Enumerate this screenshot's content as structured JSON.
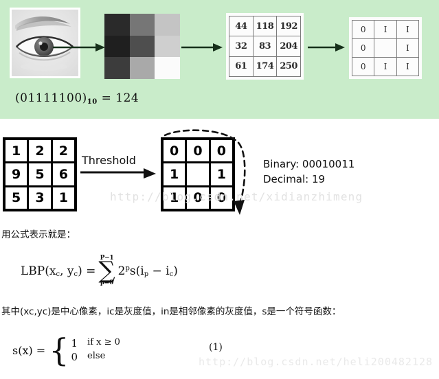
{
  "colors": {
    "panel_background": "#c9ecca",
    "page_background": "#ffffff",
    "arrow": "#16301a",
    "matrix_border": "#7b7b7b",
    "watermark": "#e2e2e2",
    "variable_blue": "#1a3fd0"
  },
  "green_panel": {
    "eye_image_alt": "grayscale eye photograph",
    "gray_patch": {
      "caption": "3x3 grayscale neighbourhood",
      "cells": [
        "#2a2a2a",
        "#767676",
        "#c4c4c4",
        "#1f1f1f",
        "#4e4e4e",
        "#cfcfcf",
        "#3c3c3c",
        "#a9a9a9",
        "#fbfbfb"
      ]
    },
    "numeric_matrix": {
      "rows": [
        [
          "44",
          "118",
          "192"
        ],
        [
          "32",
          "83",
          "204"
        ],
        [
          "61",
          "174",
          "250"
        ]
      ]
    },
    "binary_matrix": {
      "rows": [
        [
          "0",
          "I",
          "I"
        ],
        [
          "0",
          "",
          "I"
        ],
        [
          "0",
          "I",
          "I"
        ]
      ]
    },
    "caption": {
      "binary": "(01111100)",
      "base": "10",
      "equals": " = 124"
    }
  },
  "threshold_diagram": {
    "source_matrix": {
      "rows": [
        [
          "1",
          "2",
          "2"
        ],
        [
          "9",
          "5",
          "6"
        ],
        [
          "5",
          "3",
          "1"
        ]
      ]
    },
    "threshold_label": "Threshold",
    "thresholded_matrix": {
      "rows": [
        [
          "0",
          "0",
          "0"
        ],
        [
          "1",
          "",
          "1"
        ],
        [
          "1",
          "0",
          "0"
        ]
      ]
    },
    "result": {
      "binary_line": "Binary: 00010011",
      "decimal_line": "Decimal: 19"
    }
  },
  "body_text": {
    "intro_line": "用公式表示就是：",
    "explanation_prefix": "其中",
    "explanation_center": "(x",
    "explanation_line": "是中心像素，",
    "explanation_full": "其中(xc,yc)是中心像素，ic是灰度值，in是相邻像素的灰度值，s是一个符号函数："
  },
  "formulas": {
    "lbp": {
      "lhs": "LBP(x",
      "lhs_sub1": "c",
      "lhs_mid": ", y",
      "lhs_sub2": "c",
      "lhs_end": ") =",
      "sum_upper": "P−1",
      "sum_symbol": "∑",
      "sum_lower": "p=0",
      "term_base": "2",
      "term_exp": "p",
      "term_fn": "s(i",
      "term_sub1": "p",
      "term_minus": " − i",
      "term_sub2": "c",
      "term_close": ")"
    },
    "sign_function": {
      "lhs": "s(x) =",
      "case1_value": "1",
      "case1_cond": "if x ≥ 0",
      "case2_value": "0",
      "case2_cond": "else"
    },
    "equation_number": "(1)"
  },
  "watermarks": {
    "middle": "http://blog.csdn.net/xidianzhimeng",
    "bottom": "http://blog.csdn.net/heli200482128"
  }
}
